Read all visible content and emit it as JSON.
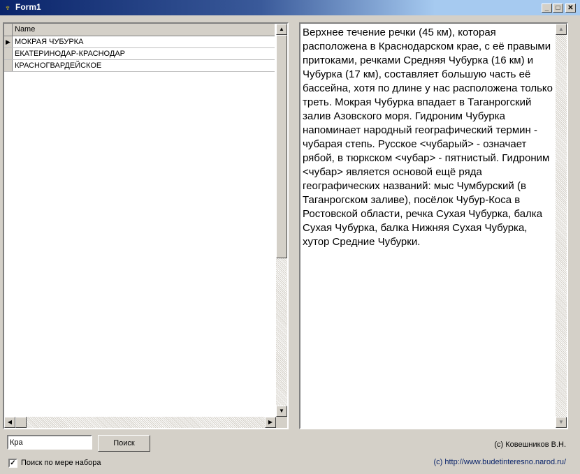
{
  "window": {
    "title": "Form1",
    "minimize_glyph": "_",
    "maximize_glyph": "□",
    "close_glyph": "✕"
  },
  "grid": {
    "column_header": "Name",
    "rows": [
      {
        "name": "МОКРАЯ ЧУБУРКА",
        "current": true
      },
      {
        "name": "ЕКАТЕРИНОДАР-КРАСНОДАР",
        "current": false
      },
      {
        "name": "КРАСНОГВАРДЕЙСКОЕ",
        "current": false
      }
    ]
  },
  "memo": {
    "text": "Верхнее течение речки (45 км), которая расположена в Краснодарском крае, с её правыми притоками, речками Средняя Чубурка (16 км) и Чубурка (17 км), составляет большую часть её бассейна, хотя по длине у нас расположена только треть. Мокрая Чубурка впадает в Таганрогский залив Азовского моря. Гидроним Чубурка напоминает народный географический термин - чубарая степь. Русское <чубарый> - означает рябой, в тюркском <чубар> - пятнистый. Гидроним <чубар> является основой ещё ряда географических названий: мыс Чумбурский (в Таганрогском заливе), посёлок Чубур-Коса в Ростовской области, речка Сухая Чубурка, балка Сухая Чубурка, балка Нижняя Сухая Чубурка, хутор Средние Чубурки."
  },
  "search": {
    "value": "Кра",
    "button_label": "Поиск",
    "incremental_label": "Поиск по мере набора",
    "incremental_checked": true
  },
  "footer": {
    "copyright": "(c) Ковешников В.Н.",
    "url": "(c) http://www.budetinteresno.narod.ru/"
  }
}
